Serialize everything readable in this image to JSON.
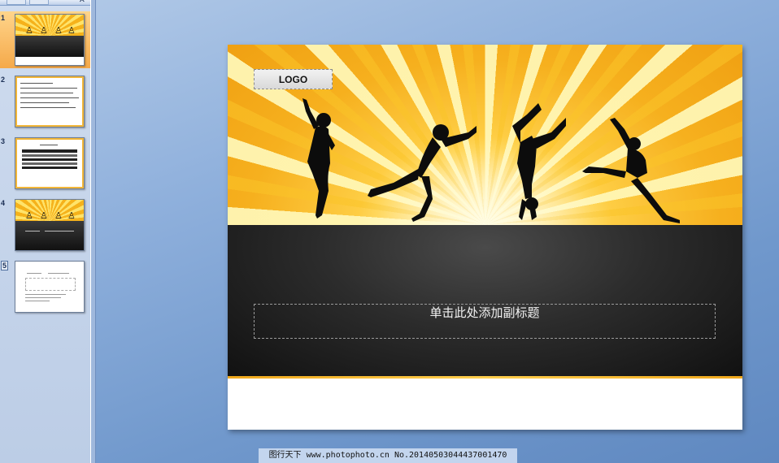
{
  "thumbnail_pane": {
    "close_glyph": "✕",
    "slides": [
      {
        "number": "1",
        "kind": "title-sunburst",
        "active": true
      },
      {
        "number": "2",
        "kind": "text-list",
        "active": false
      },
      {
        "number": "3",
        "kind": "table",
        "active": false
      },
      {
        "number": "4",
        "kind": "title-sunburst",
        "active": false
      },
      {
        "number": "5",
        "kind": "diagram",
        "active": false
      }
    ]
  },
  "slide": {
    "logo_text": "LOGO",
    "subtitle_placeholder": "单击此处添加副标题"
  },
  "watermark": {
    "text": "图行天下 www.photophoto.cn  No.20140503044437001470"
  },
  "colors": {
    "sun_yellow": "#ffd24a",
    "sun_orange": "#f0a012",
    "band_dark": "#2c2c2c",
    "accent_line": "#f0a81c",
    "active_thumb": "#f5a94a"
  }
}
